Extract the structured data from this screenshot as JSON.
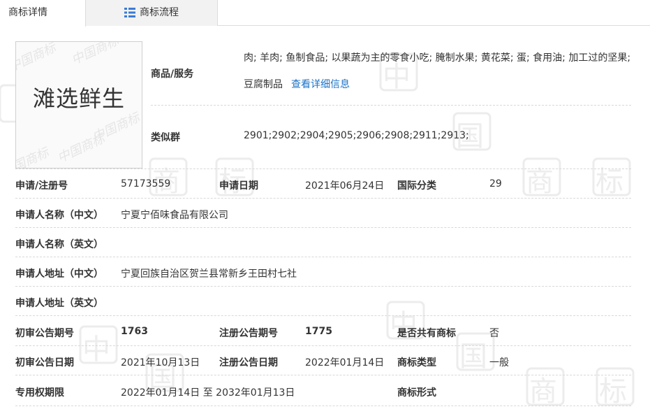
{
  "tabs": [
    {
      "label": "商标详情",
      "active": true
    },
    {
      "label": "商标流程",
      "active": false,
      "icon": "list-icon"
    }
  ],
  "logo": {
    "text": "滩选鲜生",
    "watermark": "中国商标"
  },
  "watermark_chars": [
    "中",
    "国",
    "商",
    "标"
  ],
  "goods_services": {
    "label": "商品/服务",
    "value": "肉; 羊肉; 鱼制食品; 以果蔬为主的零食小吃; 腌制水果; 黄花菜; 蛋; 食用油; 加工过的坚果; 豆腐制品",
    "link": "查看详细信息"
  },
  "similar_group": {
    "label": "类似群",
    "value": "2901;2902;2904;2905;2906;2908;2911;2913;"
  },
  "rows": {
    "reg_no": {
      "label": "申请/注册号",
      "value": "57173559"
    },
    "apply_date": {
      "label": "申请日期",
      "value": "2021年06月24日"
    },
    "intl_class": {
      "label": "国际分类",
      "value": "29"
    },
    "applicant_cn": {
      "label": "申请人名称（中文）",
      "value": "宁夏宁佰味食品有限公司"
    },
    "applicant_en": {
      "label": "申请人名称（英文）",
      "value": ""
    },
    "address_cn": {
      "label": "申请人地址（中文）",
      "value": "宁夏回族自治区贺兰县常新乡王田村七社"
    },
    "address_en": {
      "label": "申请人地址（英文）",
      "value": ""
    },
    "prelim_no": {
      "label": "初审公告期号",
      "value": "1763"
    },
    "reg_pub_no": {
      "label": "注册公告期号",
      "value": "1775"
    },
    "shared": {
      "label": "是否共有商标",
      "value": "否"
    },
    "prelim_date": {
      "label": "初审公告日期",
      "value": "2021年10月13日"
    },
    "reg_pub_date": {
      "label": "注册公告日期",
      "value": "2022年01月14日"
    },
    "tm_type": {
      "label": "商标类型",
      "value": "一般"
    },
    "exclusive_period": {
      "label": "专用权期限",
      "value": "2022年01月14日 至 2032年01月13日"
    },
    "tm_form": {
      "label": "商标形式",
      "value": ""
    }
  },
  "colors": {
    "link": "#1a73c8",
    "watermark": "#eeeeee",
    "border": "#dcdcdc"
  }
}
